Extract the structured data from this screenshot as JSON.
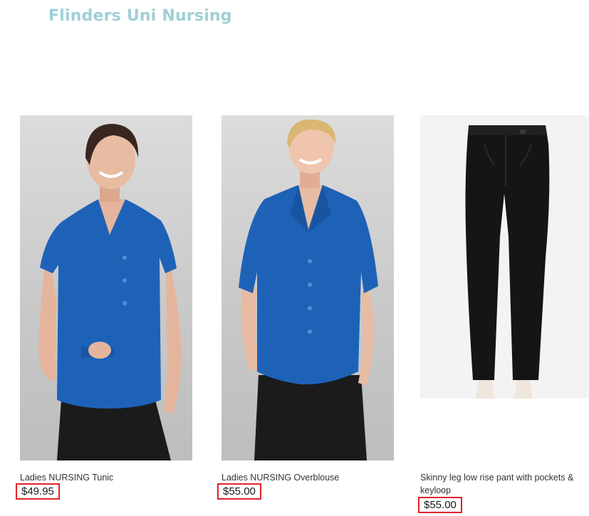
{
  "category": {
    "title": "Flinders Uni Nursing"
  },
  "colors": {
    "title": "#9fcfd6",
    "price_highlight": "#e0242a",
    "garment_blue": "#1e62b8",
    "skirt_black": "#1b1b1b"
  },
  "products": [
    {
      "name": "Ladies NURSING Tunic",
      "price": "$49.95",
      "image_icon": "model-tunic-image"
    },
    {
      "name": "Ladies NURSING Overblouse",
      "price": "$55.00",
      "image_icon": "model-overblouse-image"
    },
    {
      "name": "Skinny leg low rise pant with pockets & keyloop",
      "price": "$55.00",
      "image_icon": "black-pants-image"
    }
  ]
}
